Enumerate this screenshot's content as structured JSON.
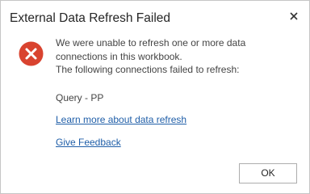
{
  "dialog": {
    "title": "External Data Refresh Failed",
    "message_lines": [
      "We were unable to refresh one or more data",
      "connections in this workbook.",
      "The following connections failed to refresh:"
    ],
    "failed_connection": "Query - PP",
    "learn_more_link": "Learn more about data refresh",
    "feedback_link": "Give Feedback",
    "ok_label": "OK"
  },
  "icons": {
    "close": "close-icon",
    "error": "error-icon"
  },
  "colors": {
    "error_red": "#d9432f",
    "link_blue": "#1f5ea8",
    "text": "#444444",
    "title_text": "#262626"
  }
}
